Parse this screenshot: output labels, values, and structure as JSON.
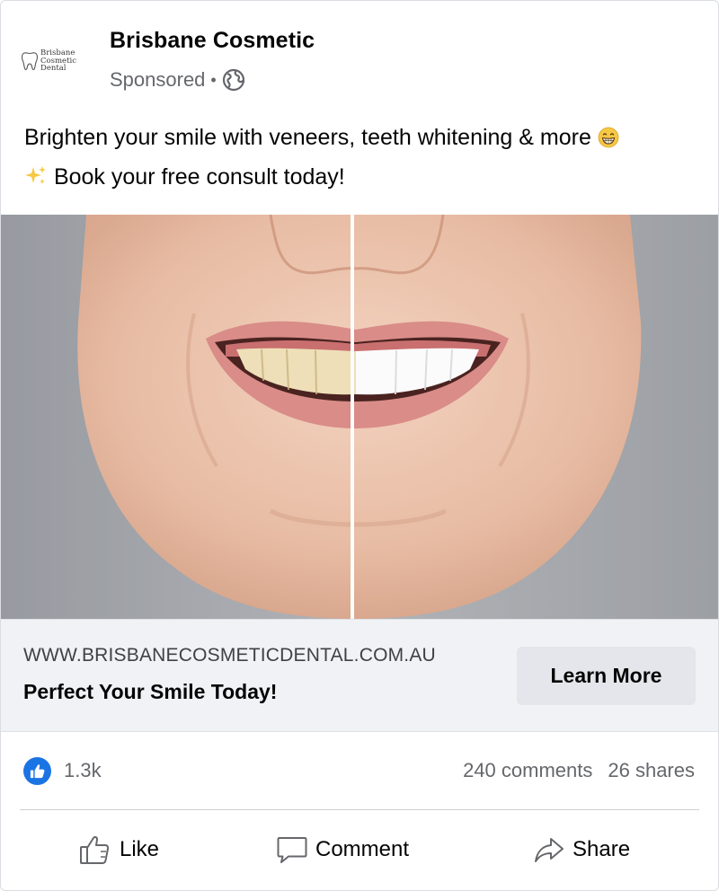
{
  "post": {
    "page_name": "Brisbane Cosmetic",
    "sponsored_label": "Sponsored",
    "separator": "•",
    "logo_lines": [
      "Brisbane",
      "Cosmetic",
      "Dental"
    ],
    "caption_line1": "Brighten your smile with veneers, teeth whitening & more",
    "caption_emoji1": "😁",
    "caption_emoji2": "✨",
    "caption_line2": "Book your free consult today!"
  },
  "image": {
    "icon": "teeth-whitening-before-after-photo",
    "background_color": "#a3a6ab"
  },
  "link": {
    "domain": "WWW.BRISBANECOSMETICDENTAL.COM.AU",
    "headline": "Perfect Your Smile Today!",
    "cta_label": "Learn More"
  },
  "engagement": {
    "likes": "1.3k",
    "comments": "240 comments",
    "shares": "26 shares"
  },
  "actions": {
    "like_label": "Like",
    "comment_label": "Comment",
    "share_label": "Share"
  },
  "colors": {
    "accent_blue": "#1b74e4",
    "secondary_text": "#65676b",
    "link_bar_bg": "#f0f2f5",
    "button_bg": "#e4e6eb"
  }
}
